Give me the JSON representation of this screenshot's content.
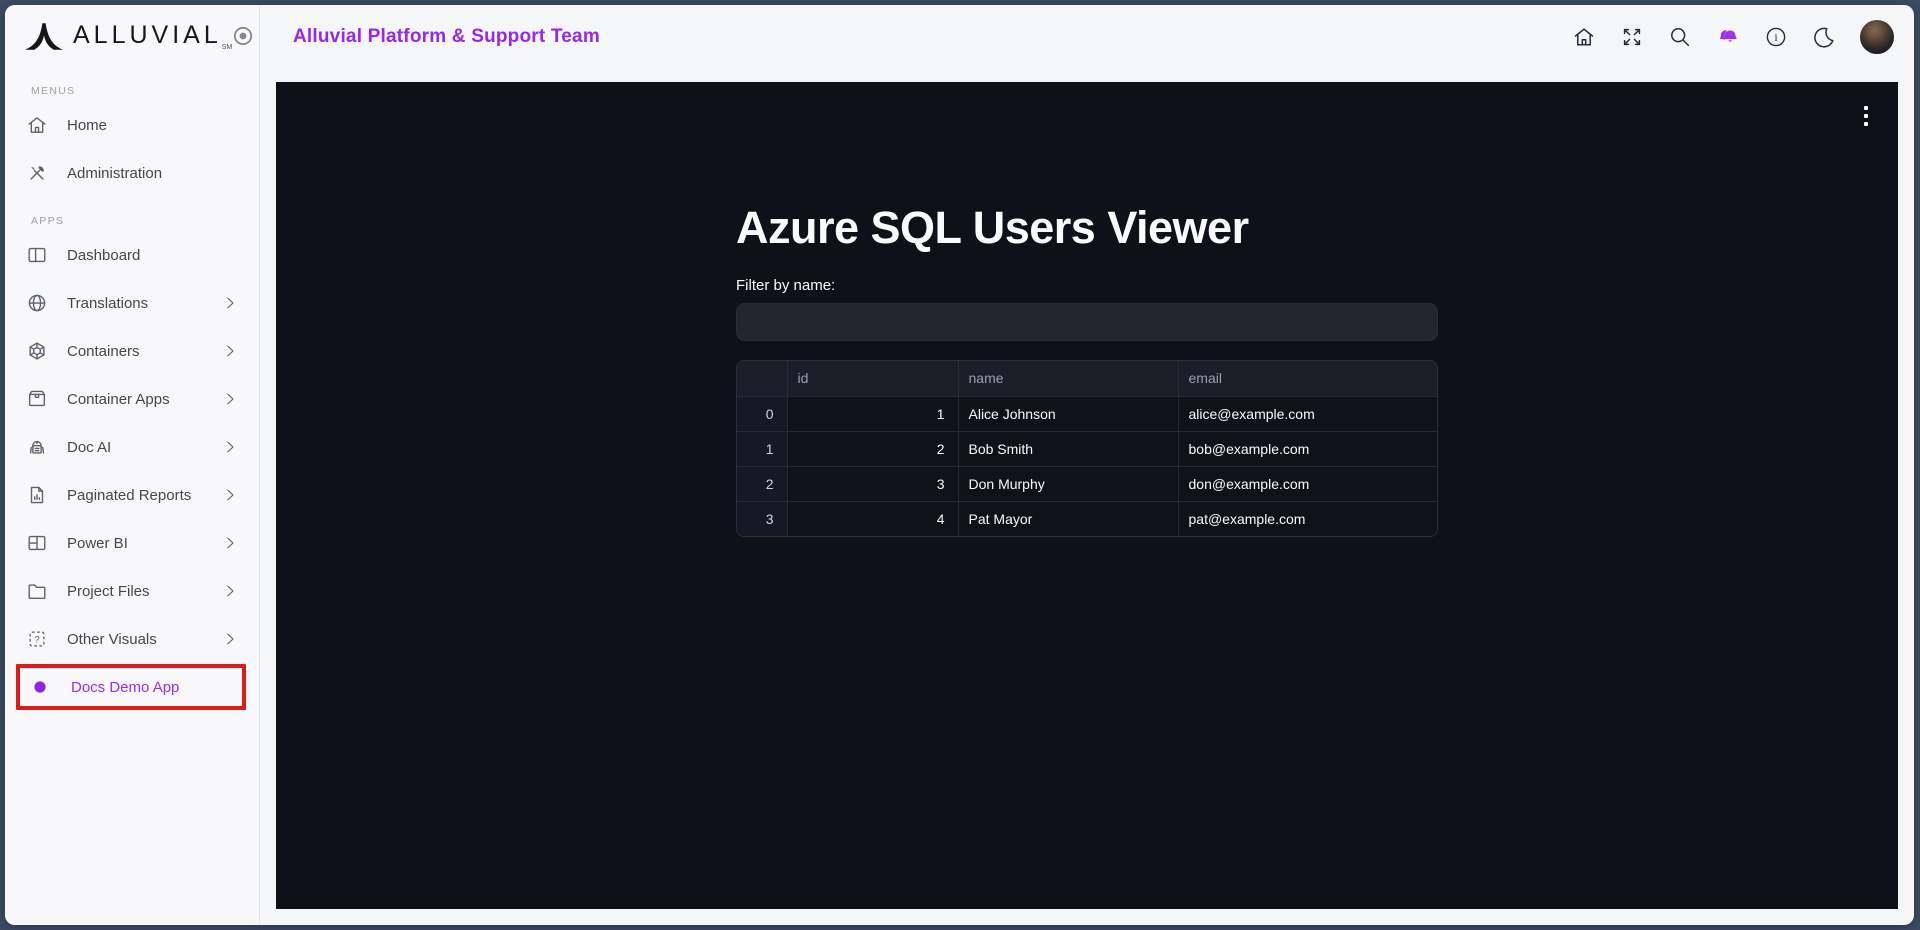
{
  "brand": {
    "name": "ALLUVIAL",
    "trademark": "SM"
  },
  "sidebar": {
    "sections": [
      {
        "label": "MENUS",
        "items": [
          {
            "label": "Home",
            "icon": "home-icon"
          },
          {
            "label": "Administration",
            "icon": "tools-icon"
          }
        ]
      },
      {
        "label": "APPS",
        "items": [
          {
            "label": "Dashboard",
            "icon": "dashboard-icon"
          },
          {
            "label": "Translations",
            "icon": "globe-icon"
          },
          {
            "label": "Containers",
            "icon": "hexagon-icon"
          },
          {
            "label": "Container Apps",
            "icon": "package-icon"
          },
          {
            "label": "Doc AI",
            "icon": "robot-icon"
          },
          {
            "label": "Paginated Reports",
            "icon": "report-icon"
          },
          {
            "label": "Power BI",
            "icon": "panes-icon"
          },
          {
            "label": "Project Files",
            "icon": "folder-icon"
          },
          {
            "label": "Other Visuals",
            "icon": "question-box-icon"
          },
          {
            "label": "Docs Demo App",
            "icon": "purple-dot-icon",
            "highlighted": true
          }
        ]
      }
    ]
  },
  "header": {
    "title": "Alluvial Platform & Support Team",
    "icons": [
      "home-icon",
      "expand-icon",
      "search-icon",
      "notifications-bells-icon",
      "info-icon",
      "dark-mode-moon-icon",
      "avatar"
    ]
  },
  "app": {
    "title": "Azure SQL Users Viewer",
    "filter": {
      "label": "Filter by name:",
      "value": "",
      "placeholder": ""
    },
    "table": {
      "columns": [
        "",
        "id",
        "name",
        "email"
      ],
      "rows": [
        {
          "index": "0",
          "id": "1",
          "name": "Alice Johnson",
          "email": "alice@example.com"
        },
        {
          "index": "1",
          "id": "2",
          "name": "Bob Smith",
          "email": "bob@example.com"
        },
        {
          "index": "2",
          "id": "3",
          "name": "Don Murphy",
          "email": "don@example.com"
        },
        {
          "index": "3",
          "id": "4",
          "name": "Pat Mayor",
          "email": "pat@example.com"
        }
      ]
    }
  },
  "colors": {
    "accent_purple": "#9527f0",
    "notification_purple": "#a32ef5",
    "annotation_red": "#df1a1a",
    "panel_background": "#0e1117",
    "frame_background": "#3e4c64"
  }
}
